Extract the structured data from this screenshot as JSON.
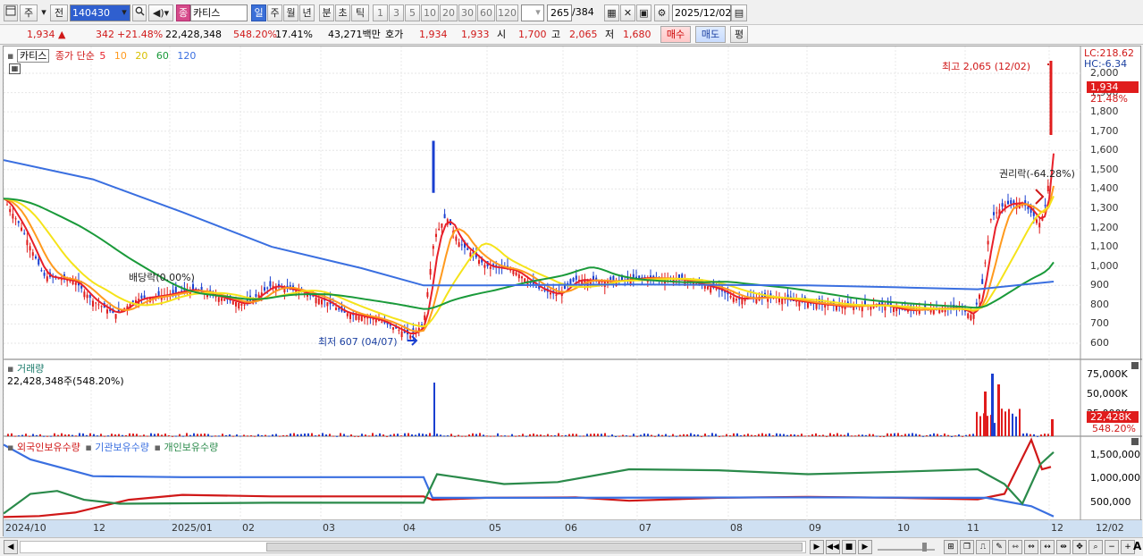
{
  "toolbar": {
    "period_unit": "주",
    "prev_label": "전",
    "code": "140430",
    "category_badge": "종",
    "stock_name": "카티스",
    "periods": [
      "일",
      "주",
      "월",
      "년",
      "분",
      "초",
      "틱"
    ],
    "intervals": [
      "1",
      "3",
      "5",
      "10",
      "20",
      "30",
      "60",
      "120"
    ],
    "page_count": "265",
    "page_total": "/384",
    "date": "2025/12/02"
  },
  "quote": {
    "price": "1,934",
    "change": "342",
    "change_pct": "+21.48%",
    "volume": "22,428,348",
    "volume_ratio": "548.20%",
    "turnover_pct": "17.41%",
    "amount": "43,271백만",
    "hoga_label": "호가",
    "ask": "1,934",
    "bid": "1,933",
    "open_label": "시",
    "open": "1,700",
    "high_label": "고",
    "high": "2,065",
    "low_label": "저",
    "low": "1,680",
    "buy_label": "매수",
    "sell_label": "매도",
    "eval_label": "평"
  },
  "legend": {
    "stock_tab": "카티스",
    "ma_label": "종가 단순",
    "ma_periods": [
      "5",
      "10",
      "20",
      "60",
      "120"
    ],
    "ma_colors": [
      "#e8202a",
      "#ff9a1e",
      "#f5e31a",
      "#1a9a3a",
      "#3a6fe0"
    ]
  },
  "price_axis": {
    "lc": "LC:218.62",
    "hc": "HC:-6.34",
    "ticks": [
      "2,000",
      "1,900",
      "1,800",
      "1,700",
      "1,600",
      "1,500",
      "1,400",
      "1,300",
      "1,200",
      "1,100",
      "1,000",
      "900",
      "800",
      "700",
      "600"
    ],
    "current_price": "1,934",
    "current_pct": "21.48%"
  },
  "annotations": {
    "high_marker": "최고 2,065 (12/02)",
    "low_marker": "최저 607 (04/07)",
    "dividend": "배당락(0.00%)",
    "rights": "권리락(-64.28%)"
  },
  "volume_pane": {
    "title": "거래량",
    "value": "22,428,348주(548.20%)",
    "ticks": [
      "75,000K",
      "50,000K",
      "25,000K"
    ],
    "current": "22,428K",
    "current_pct": "548.20%"
  },
  "holdings_pane": {
    "series": [
      "외국인보유수량",
      "기관보유수량",
      "개인보유수량"
    ],
    "series_colors": [
      "#d01818",
      "#3a6fe0",
      "#2a8a4a"
    ],
    "ticks": [
      "1,500,000",
      "1,000,000",
      "500,000"
    ]
  },
  "x_axis": {
    "labels": [
      "2024/10",
      "12",
      "2025/01",
      "02",
      "03",
      "04",
      "05",
      "06",
      "07",
      "08",
      "09",
      "10",
      "11",
      "12"
    ],
    "current": "12/02"
  }
}
